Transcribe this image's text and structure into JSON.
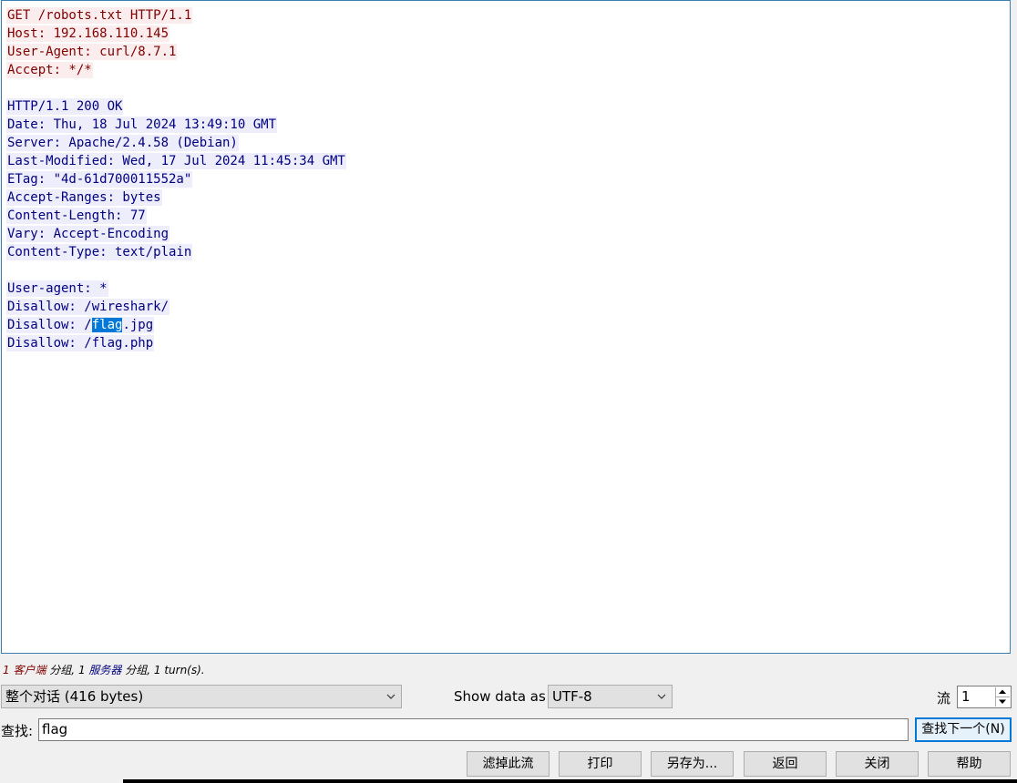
{
  "stream": {
    "client_request": [
      "GET /robots.txt HTTP/1.1",
      "Host: 192.168.110.145",
      "User-Agent: curl/8.7.1",
      "Accept: */*"
    ],
    "server_response_headers": [
      "HTTP/1.1 200 OK",
      "Date: Thu, 18 Jul 2024 13:49:10 GMT",
      "Server: Apache/2.4.58 (Debian)",
      "Last-Modified: Wed, 17 Jul 2024 11:45:34 GMT",
      "ETag: \"4d-61d700011552a\"",
      "Accept-Ranges: bytes",
      "Content-Length: 77",
      "Vary: Accept-Encoding",
      "Content-Type: text/plain"
    ],
    "server_response_body": [
      "User-agent: *",
      "Disallow: /wireshark/"
    ],
    "highlight_line": {
      "before": "Disallow: /",
      "match": "flag",
      "after": ".jpg"
    },
    "last_line": "Disallow: /flag.php"
  },
  "summary": {
    "client_count": "1",
    "client_label": "客户端",
    "client_suffix": " 分组,",
    "server_count": " 1",
    "server_label": "服务器",
    "server_suffix": " 分组,",
    "turns": " 1 turn(s)."
  },
  "controls": {
    "conversation_select": "整个对话 (416 bytes)",
    "show_data_as_label": "Show data as",
    "encoding_select": "UTF-8",
    "stream_label": "流",
    "stream_value": "1",
    "find_label": "查找:",
    "find_value": "flag",
    "find_next_button": "查找下一个(N)"
  },
  "buttons": {
    "filter_out": "滤掉此流",
    "print": "打印",
    "save_as": "另存为...",
    "back": "返回",
    "close": "关闭",
    "help": "帮助"
  },
  "colors": {
    "client_text": "#7f0000",
    "client_bg": "#fbeded",
    "server_text": "#00007f",
    "server_bg": "#ededfb",
    "selection": "#0078d7"
  },
  "icons": {
    "dropdown": "chevron-down-icon",
    "spin_up": "triangle-up-icon",
    "spin_down": "triangle-down-icon"
  }
}
